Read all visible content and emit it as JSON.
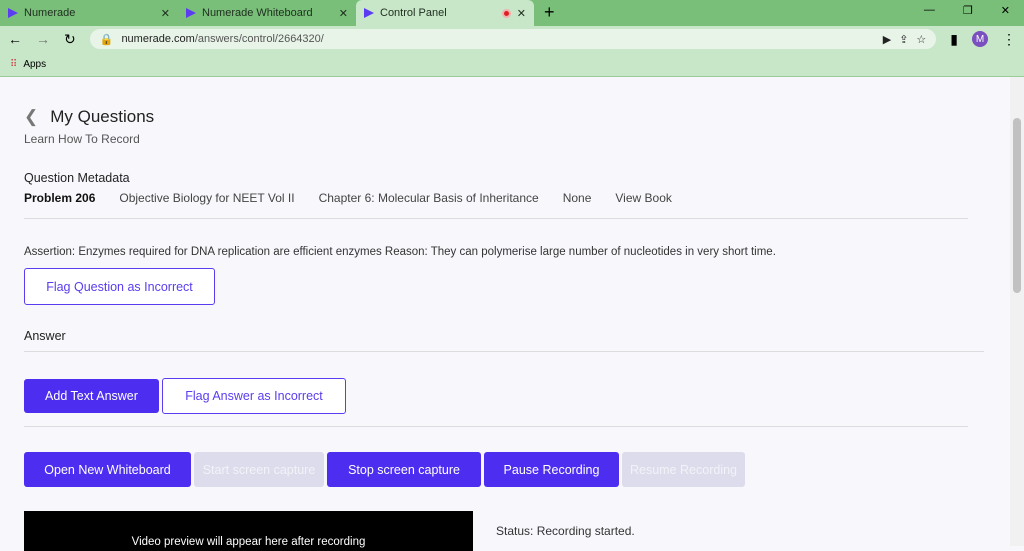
{
  "browser": {
    "tabs": [
      {
        "label": "Numerade"
      },
      {
        "label": "Numerade Whiteboard"
      },
      {
        "label": "Control Panel"
      }
    ],
    "url_host": "numerade.com",
    "url_path": "/answers/control/2664320/",
    "avatar": "M",
    "bookmark": "Apps"
  },
  "page": {
    "title": "My Questions",
    "learn": "Learn How To Record",
    "meta_heading": "Question Metadata",
    "meta": {
      "problem": "Problem 206",
      "book": "Objective Biology for NEET Vol II",
      "chapter": "Chapter 6: Molecular Basis of Inheritance",
      "section": "None",
      "view_book": "View Book"
    },
    "question": "Assertion: Enzymes required for DNA replication are efficient enzymes Reason: They can polymerise large number of nucleotides in very short time.",
    "flag_question": "Flag Question as Incorrect",
    "answer_heading": "Answer",
    "add_text": "Add Text Answer",
    "flag_answer": "Flag Answer as Incorrect",
    "buttons": {
      "open_whiteboard": "Open New Whiteboard",
      "start_capture": "Start screen capture",
      "stop_capture": "Stop screen capture",
      "pause": "Pause Recording",
      "resume": "Resume Recording"
    },
    "video_placeholder": "Video preview will appear here after recording",
    "status": "Status: Recording started."
  }
}
